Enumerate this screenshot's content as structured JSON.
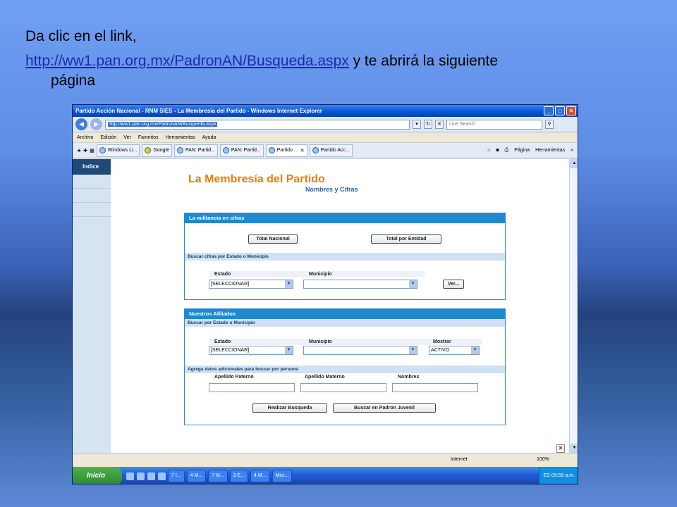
{
  "slide": {
    "line1": "Da clic en el link,",
    "link": "http://ww1.pan.org.mx/PadronAN/Busqueda.aspx",
    "after_link": " y te abrirá la siguiente",
    "line3": "página"
  },
  "browser": {
    "title": "Partido Acción Nacional - RNM SIES - La Membresía del Partido - Windows Internet Explorer",
    "address": "http://ww1.pan.org.mx/PadronAN/Busqueda.aspx",
    "live_search": "Live Search",
    "menu": [
      "Archivo",
      "Edición",
      "Ver",
      "Favoritos",
      "Herramientas",
      "Ayuda"
    ],
    "tabs": [
      "Windows Li...",
      "Google",
      "PAN: Partid...",
      "PAN: Partid...",
      "Partido ...",
      "Partido Acc..."
    ],
    "cmd_page": "Página",
    "cmd_tools": "Herramientas"
  },
  "site": {
    "sidebar_label": "Indice",
    "brand_title": "La Membresía del Partido",
    "brand_sub": "Nombres y Cifras",
    "panel1": {
      "head": "La militancia en cifras",
      "btn_total_nacional": "Total Nacional",
      "btn_total_entidad": "Total por Entidad",
      "bar": "Buscar cifras por Estado o Municipio",
      "lbl_estado": "Estado",
      "lbl_municipio": "Municipio",
      "estado_value": "[SELECCIONAR]",
      "btn_ver": "Ver..."
    },
    "panel2": {
      "head": "Nuestros Afiliados",
      "bar1": "Buscar por Estado o Municipio",
      "lbl_estado": "Estado",
      "lbl_municipio": "Municipio",
      "lbl_mostrar": "Mostrar",
      "estado_value": "[SELECCIONAR]",
      "mostrar_value": "ACTIVO",
      "bar2": "Agrega datos adicionales para buscar por persona",
      "lbl_paterno": "Apellido Paterno",
      "lbl_materno": "Apellido Materno",
      "lbl_nombres": "Nombres",
      "btn_buscar": "Realizar Busqueda",
      "btn_juvenil": "Buscar en Padron Juvenil"
    }
  },
  "status": {
    "zone": "Internet",
    "zoom": "100%"
  },
  "taskbar": {
    "start": "Inicio",
    "buttons": [
      "7 I...",
      "4 M...",
      "7 M...",
      "3 E...",
      "4 M...",
      "Micr..."
    ],
    "lang": "ES",
    "clock": "09:59 a.m."
  }
}
